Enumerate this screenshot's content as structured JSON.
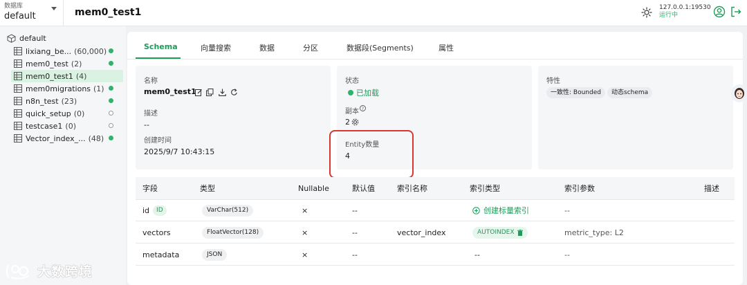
{
  "header": {
    "db_label": "数据库",
    "db_value": "default",
    "title": "mem0_test1",
    "server_address": "127.0.0.1:19530",
    "server_status": "运行中",
    "icons": [
      "sun-icon",
      "user-circle-icon",
      "logout-icon",
      "chevron-down-icon"
    ]
  },
  "sidebar": {
    "root": "default",
    "items": [
      {
        "name": "lixiang_be...",
        "count": "(60,000)",
        "loaded": true
      },
      {
        "name": "mem0_test",
        "count": "(2)",
        "loaded": true
      },
      {
        "name": "mem0_test1",
        "count": "(4)",
        "loaded": true,
        "active": true
      },
      {
        "name": "mem0migrations",
        "count": "(1)",
        "loaded": true
      },
      {
        "name": "n8n_test",
        "count": "(23)",
        "loaded": true
      },
      {
        "name": "quick_setup",
        "count": "(0)",
        "loaded": false
      },
      {
        "name": "testcase1",
        "count": "(0)",
        "loaded": false
      },
      {
        "name": "Vector_index_...",
        "count": "(48)",
        "loaded": true
      }
    ]
  },
  "tabs": [
    "Schema",
    "向量搜索",
    "数据",
    "分区",
    "数据段(Segments)",
    "属性"
  ],
  "info": {
    "name_label": "名称",
    "name_value": "mem0_test1",
    "desc_label": "描述",
    "desc_value": "--",
    "created_label": "创建时间",
    "created_value": "2025/9/7 10:43:15",
    "status_label": "状态",
    "status_value": "已加载",
    "replica_label": "副本",
    "replica_value": "2",
    "entity_label": "Entity数量",
    "entity_value": "4",
    "features_label": "特性",
    "feature_consistency": "一致性: Bounded",
    "feature_dynamic": "动态schema"
  },
  "table": {
    "headers": [
      "字段",
      "类型",
      "Nullable",
      "默认值",
      "索引名称",
      "索引类型",
      "索引参数",
      "描述"
    ],
    "rows": [
      {
        "field": "id",
        "tag": "ID",
        "type": "VarChar(512)",
        "nullable": "×",
        "default": "--",
        "index_name": "",
        "index_type": "创建标量索引",
        "index_params": "--"
      },
      {
        "field": "vectors",
        "tag": "",
        "type": "FloatVector(128)",
        "nullable": "×",
        "default": "--",
        "index_name": "vector_index",
        "index_type": "AUTOINDEX",
        "index_params": "metric_type: L2"
      },
      {
        "field": "metadata",
        "tag": "",
        "type": "JSON",
        "nullable": "×",
        "default": "--",
        "index_name": "",
        "index_type": "--",
        "index_params": "--"
      }
    ]
  },
  "watermark": "大数跨境",
  "colors": {
    "accent": "#1e9a5a",
    "loaded_dot": "#2db36b",
    "highlight": "#d8362f"
  }
}
